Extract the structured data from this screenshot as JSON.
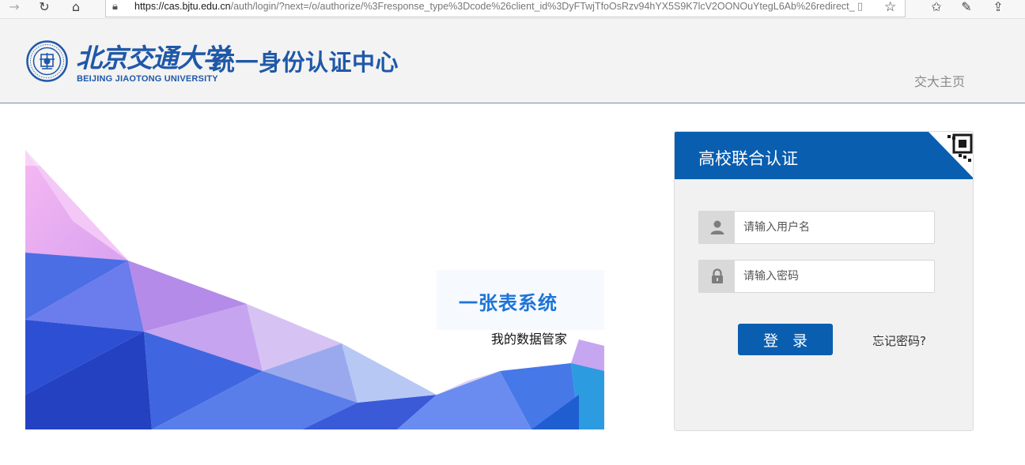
{
  "browser": {
    "url_host": "https://cas.bjtu.edu.cn",
    "url_rest": "/auth/login/?next=/o/authorize/%3Fresponse_type%3Dcode%26client_id%3DyFTwjTfoOsRzv94hYX5S9K7lcV2OONOuYtegL6Ab%26redirect_",
    "icons": [
      "forward-icon",
      "refresh-icon",
      "home-icon",
      "lock-icon",
      "reading-view-icon",
      "favorite-star-icon",
      "favorites-icon",
      "pen-icon",
      "share-icon"
    ]
  },
  "header": {
    "school_cn": "北京交通大学",
    "school_en": "BEIJING JIAOTONG UNIVERSITY",
    "system_title": "统一身份认证中心",
    "home_link": "交大主页"
  },
  "banner": {
    "slogan": "一张表系统",
    "subtitle": "我的数据管家"
  },
  "login": {
    "title": "高校联合认证",
    "username_placeholder": "请输入用户名",
    "password_placeholder": "请输入密码",
    "username_value": "",
    "password_value": "",
    "submit_label": "登 录",
    "forgot_label": "忘记密码?"
  },
  "colors": {
    "brand_blue": "#0a5eb0",
    "logo_blue": "#1f58a8",
    "slogan_blue": "#1d74d6",
    "header_bg": "#f3f3f3",
    "panel_bg": "#f1f1f1"
  }
}
